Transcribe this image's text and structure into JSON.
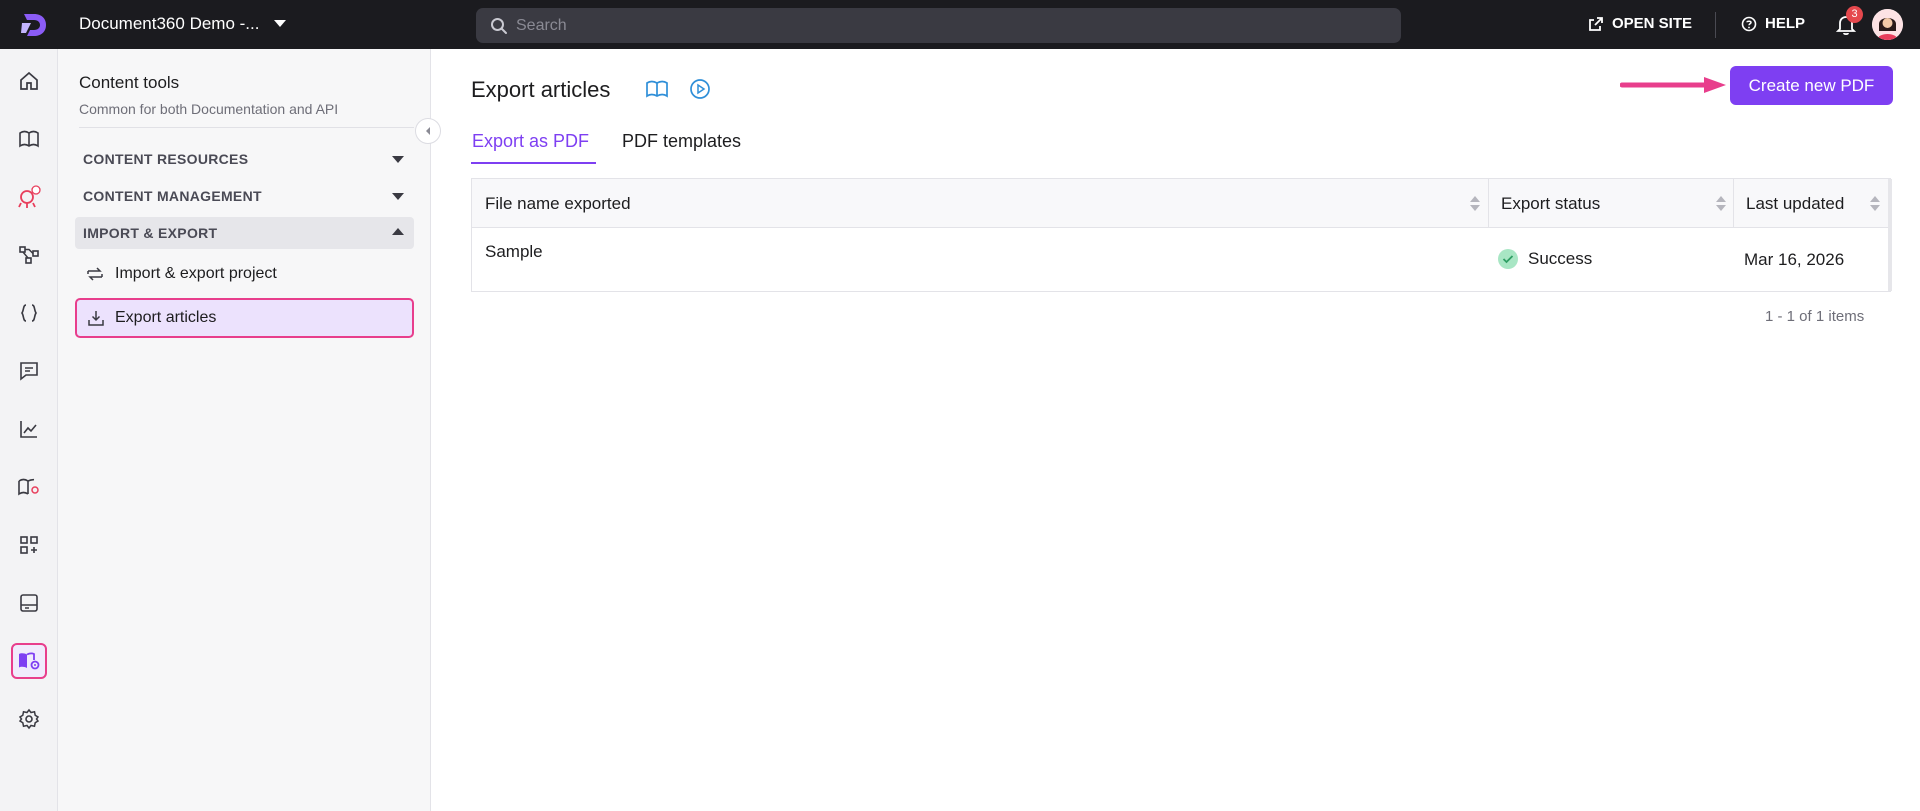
{
  "topbar": {
    "project_name": "Document360 Demo -...",
    "search_placeholder": "Search",
    "open_site": "OPEN SITE",
    "help": "HELP",
    "notifications_count": "3"
  },
  "rail": {
    "icons": [
      "home-icon",
      "book-icon",
      "eddy-ai-icon",
      "workflow-icon",
      "api-icon",
      "feedback-icon",
      "analytics-icon",
      "knowledge-base-icon",
      "integrations-icon",
      "widget-icon",
      "content-tools-icon",
      "settings-icon"
    ],
    "active": "content-tools-icon",
    "active_color": "#e83e8c"
  },
  "sidebar": {
    "title": "Content tools",
    "subtitle": "Common for both Documentation and API",
    "sections": [
      {
        "label": "CONTENT RESOURCES",
        "expanded": false
      },
      {
        "label": "CONTENT MANAGEMENT",
        "expanded": false
      },
      {
        "label": "IMPORT & EXPORT",
        "expanded": true
      }
    ],
    "links": [
      {
        "label": "Import & export project",
        "icon": "import-export-icon",
        "active": false
      },
      {
        "label": "Export articles",
        "icon": "export-icon",
        "active": true
      }
    ]
  },
  "main": {
    "title": "Export articles",
    "create_button": "Create new PDF",
    "tabs": [
      {
        "label": "Export as PDF",
        "active": true
      },
      {
        "label": "PDF templates",
        "active": false
      }
    ],
    "table": {
      "columns": [
        "File name exported",
        "Export status",
        "Last updated"
      ],
      "rows": [
        {
          "file_name": "Sample",
          "status": "Success",
          "last_updated": "Mar 16, 2026"
        }
      ]
    },
    "pagination": "1 - 1 of 1 items"
  },
  "colors": {
    "brand": "#7e3ff2",
    "highlight": "#e83e8c",
    "topbar": "#1b1b1f",
    "success": "#a8e6c4"
  }
}
